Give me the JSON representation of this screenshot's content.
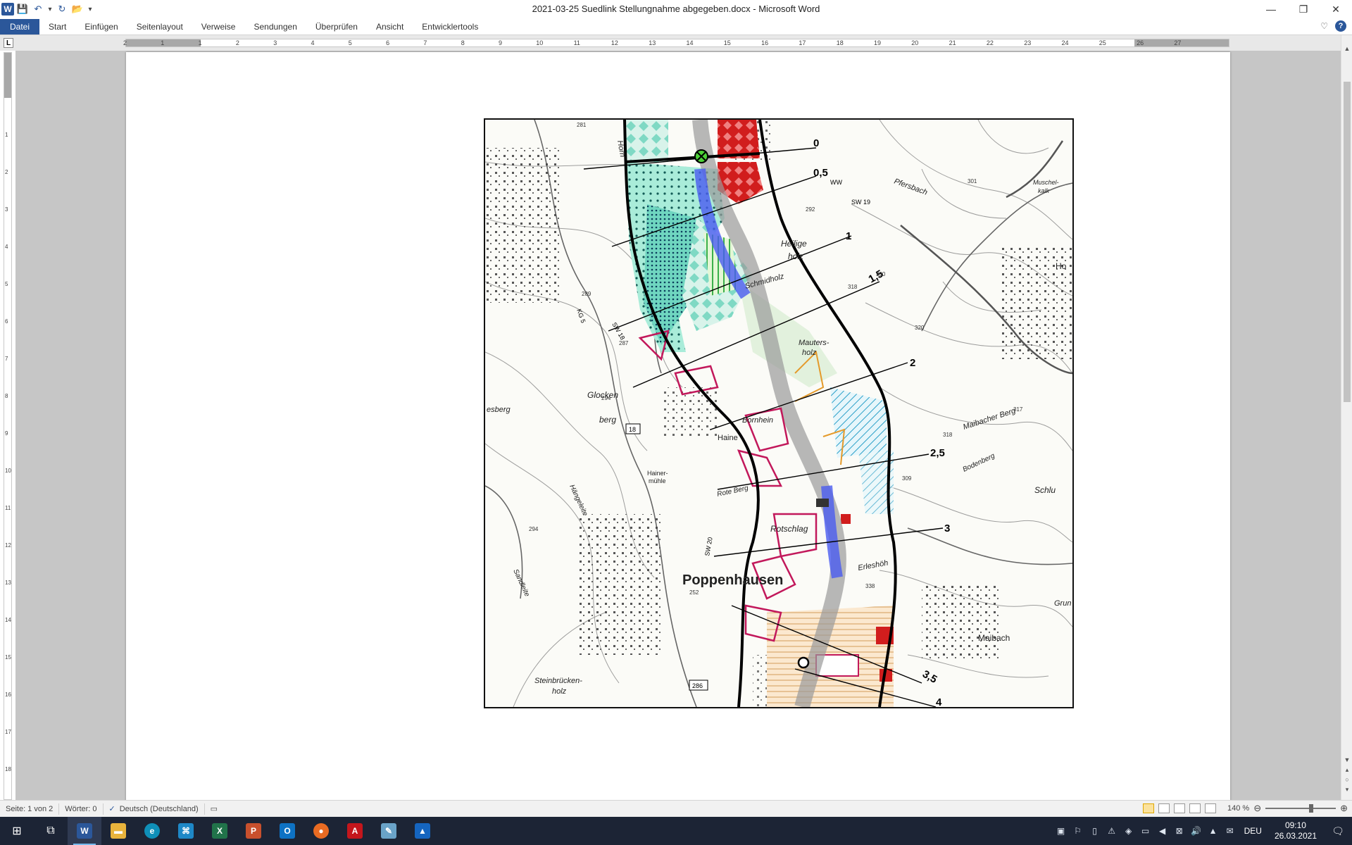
{
  "window": {
    "title": "2021-03-25 Suedlink Stellungnahme abgegeben.docx  -  Microsoft Word",
    "min": "—",
    "restore": "❐",
    "close": "✕"
  },
  "qat": {
    "app_letter": "W",
    "save": "💾",
    "undo": "↶",
    "undo_dropdown": "▾",
    "redo": "↻",
    "open": "📂",
    "customize": "▾"
  },
  "ribbon": {
    "tabs": [
      "Datei",
      "Start",
      "Einfügen",
      "Seitenlayout",
      "Verweise",
      "Sendungen",
      "Überprüfen",
      "Ansicht",
      "Entwicklertools"
    ],
    "expand": "♡",
    "help": "?"
  },
  "ruler": {
    "corner": "L",
    "h_ticks": [
      "2",
      "1",
      "1",
      "2",
      "3",
      "4",
      "5",
      "6",
      "7",
      "8",
      "9",
      "10",
      "11",
      "12",
      "13",
      "14",
      "15",
      "16",
      "17",
      "18",
      "19",
      "20",
      "21",
      "22",
      "23",
      "24",
      "25",
      "26",
      "27"
    ],
    "v_ticks": [
      "1",
      "2",
      "3",
      "4",
      "5",
      "6",
      "7",
      "8",
      "9",
      "10",
      "11",
      "12",
      "13",
      "14",
      "15",
      "16",
      "17",
      "18"
    ]
  },
  "map": {
    "place_names": [
      "Poppenhausen",
      "Glocken",
      "berg",
      "Heilige",
      "holz",
      "Mauters-",
      "holz",
      "Rotschlag",
      "Maibach",
      "Maibacher Berg",
      "Steinbrücken-",
      "holz",
      "Erleshöh",
      "Schmidholz",
      "Hängeleite",
      "Sandleite",
      "Muschel-",
      "kalk",
      "Pfersbach",
      "Ho",
      "Grun",
      "Bodenberg",
      "Schlu",
      "Hainer-",
      "mühle",
      "Bornhein",
      "Haine",
      "Rote Berg",
      "esberg",
      "Horn"
    ],
    "km_labels": [
      "0",
      "0,5",
      "1",
      "1,5",
      "2",
      "2,5",
      "3",
      "3,5",
      "4"
    ],
    "road_labels": [
      "18",
      "286",
      "SW 19",
      "SW 20",
      "SW 18",
      "KG 5",
      "WW"
    ],
    "elevations": [
      "292",
      "318",
      "300",
      "320",
      "317",
      "318",
      "309",
      "338",
      "294",
      "287",
      "289",
      "281",
      "301",
      "252",
      "294"
    ]
  },
  "status": {
    "page": "Seite: 1 von 2",
    "words": "Wörter: 0",
    "language": "Deutsch (Deutschland)",
    "zoom": "140 %",
    "zoom_out": "⊖",
    "zoom_in": "⊕"
  },
  "taskbar": {
    "apps": [
      {
        "name": "start",
        "glyph": "⊞",
        "color": "#1c2435"
      },
      {
        "name": "task-view",
        "glyph": "⧉",
        "color": "#1c2435"
      },
      {
        "name": "word",
        "glyph": "W",
        "color": "#2b579a"
      },
      {
        "name": "explorer",
        "glyph": "▬",
        "color": "#e8b33c"
      },
      {
        "name": "edge",
        "glyph": "e",
        "color": "#0f8fb8"
      },
      {
        "name": "network-app",
        "glyph": "⌘",
        "color": "#1e88c7"
      },
      {
        "name": "excel",
        "glyph": "X",
        "color": "#21734a"
      },
      {
        "name": "powerpoint",
        "glyph": "P",
        "color": "#c8502d"
      },
      {
        "name": "outlook",
        "glyph": "O",
        "color": "#0e72c4"
      },
      {
        "name": "firefox",
        "glyph": "●",
        "color": "#e96b22"
      },
      {
        "name": "acrobat",
        "glyph": "A",
        "color": "#c4161c"
      },
      {
        "name": "notepad",
        "glyph": "✎",
        "color": "#6aa3c8"
      },
      {
        "name": "photos",
        "glyph": "▲",
        "color": "#1565c0"
      }
    ],
    "tray": [
      "▣",
      "⚐",
      "▯",
      "⚠",
      "◈",
      "▭",
      "◀",
      "⊠",
      "🔊",
      "▲",
      "✉"
    ],
    "lang": "DEU",
    "time": "09:10",
    "date": "26.03.2021",
    "notifications": "🗨"
  }
}
